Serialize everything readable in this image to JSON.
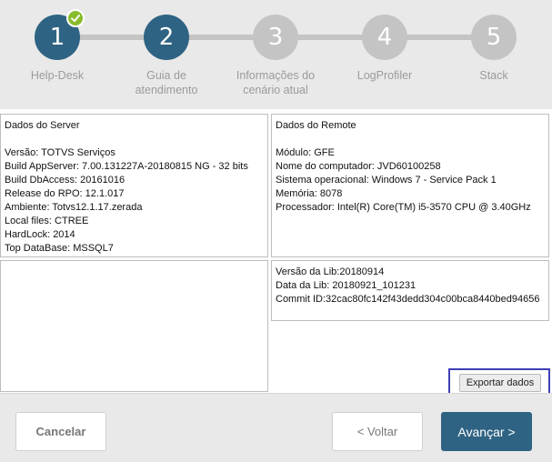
{
  "colors": {
    "active_step": "#2f6383",
    "inactive_step": "#c4c4c4",
    "check_badge": "#89bc2c",
    "primary_button": "#2f6383",
    "highlight_border": "#3f3fb5"
  },
  "stepper": {
    "steps": [
      {
        "number": "1",
        "label_line1": "Help-Desk",
        "label_line2": "",
        "state": "completed"
      },
      {
        "number": "2",
        "label_line1": "Guia de",
        "label_line2": "atendimento",
        "state": "active"
      },
      {
        "number": "3",
        "label_line1": "Informações do",
        "label_line2": "cenário atual",
        "state": "inactive"
      },
      {
        "number": "4",
        "label_line1": "LogProfiler",
        "label_line2": "",
        "state": "inactive"
      },
      {
        "number": "5",
        "label_line1": "Stack",
        "label_line2": "",
        "state": "inactive"
      }
    ],
    "completed_icon": "check-icon"
  },
  "server_panel": {
    "title": "Dados do Server",
    "lines": [
      "Versão: TOTVS Serviços",
      "Build AppServer: 7.00.131227A-20180815 NG - 32 bits",
      "Build DbAccess: 20161016",
      "Release do RPO:  12.1.017",
      "Ambiente: Totvs12.1.17.zerada",
      "Local files: CTREE",
      "HardLock: 2014",
      "Top DataBase: MSSQL7"
    ]
  },
  "remote_panel": {
    "title": "Dados do Remote",
    "lines": [
      "Módulo: GFE",
      "Nome do computador: JVD60100258",
      "Sistema operacional: Windows 7 - Service Pack 1",
      "Memória: 8078",
      "Processador: Intel(R) Core(TM) i5-3570 CPU @ 3.40GHz"
    ]
  },
  "lib_panel": {
    "lines": [
      "Versão da Lib:20180914",
      "Data da Lib: 20180921_101231",
      "Commit ID:32cac80fc142f43dedd304c00bca8440bed94656"
    ]
  },
  "export_button": {
    "label": "Exportar dados"
  },
  "footer": {
    "cancel_label": "Cancelar",
    "back_label": "< Voltar",
    "next_label": "Avançar >"
  }
}
